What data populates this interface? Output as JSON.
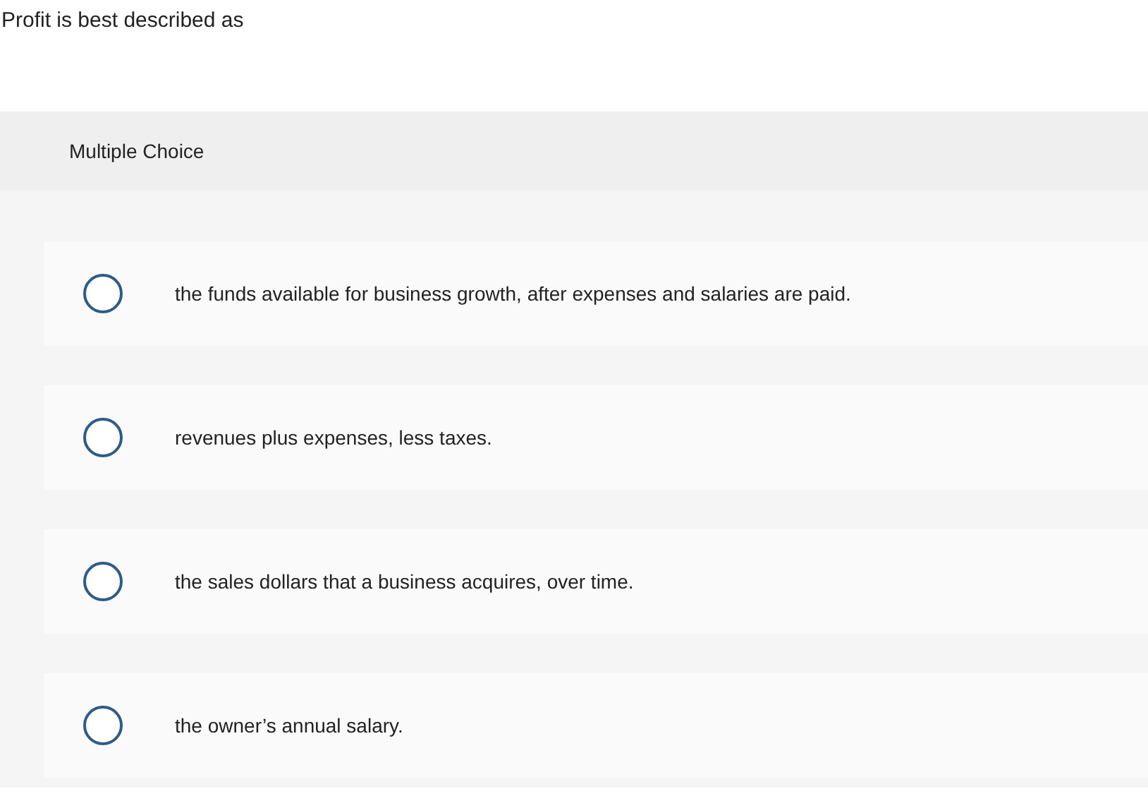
{
  "question": "Profit is best described as",
  "panel": {
    "title": "Multiple Choice"
  },
  "options": [
    {
      "label": "the funds available for business growth, after expenses and salaries are paid.",
      "selected": false
    },
    {
      "label": "revenues plus expenses, less taxes.",
      "selected": false
    },
    {
      "label": "the sales dollars that a business acquires, over time.",
      "selected": false
    },
    {
      "label": "the owner’s annual salary.",
      "selected": false
    }
  ]
}
